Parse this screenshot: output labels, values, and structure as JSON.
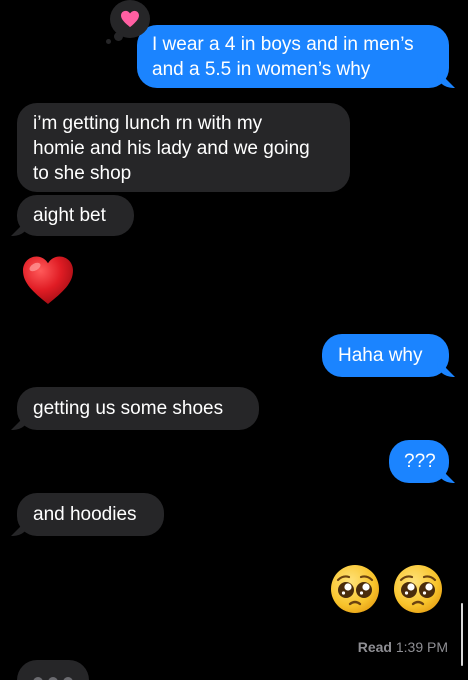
{
  "conversation": {
    "messages": [
      {
        "from": "me",
        "text": "I wear a 4 in boys and in men’s\nand a 5.5 in women’s why",
        "reaction": "heart-icon"
      },
      {
        "from": "them",
        "text": "i’m getting lunch  rn with my\nhomie and his lady and we going\nto she shop"
      },
      {
        "from": "them",
        "text": "aight bet"
      },
      {
        "from": "them",
        "emoji": "red-heart-emoji"
      },
      {
        "from": "me",
        "text": "Haha why"
      },
      {
        "from": "them",
        "text": "getting us some shoes"
      },
      {
        "from": "me",
        "text": "???"
      },
      {
        "from": "them",
        "text": "and hoodies"
      },
      {
        "from": "me",
        "emoji": "pleading-face-emoji x2"
      }
    ],
    "read_label": "Read",
    "read_time": "1:39 PM",
    "typing_indicator": true
  },
  "colors": {
    "background": "#000000",
    "sent_bubble": "#1b84ff",
    "received_bubble": "#262628",
    "reaction_heart": "#ff5fa2",
    "read_text": "#8e8e93"
  }
}
